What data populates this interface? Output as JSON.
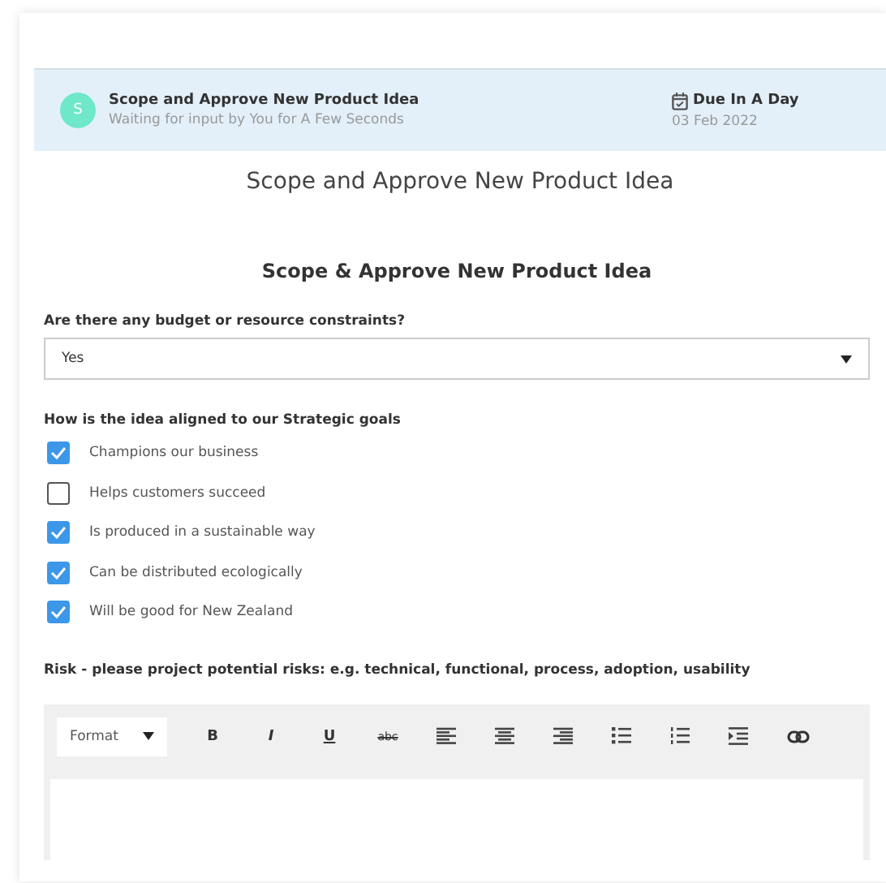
{
  "task": {
    "avatar": "S",
    "title": "Scope and Approve New Product Idea",
    "subtitle": "Waiting for input by You for A Few Seconds",
    "due": "Due In A Day",
    "date": "03 Feb 2022"
  },
  "page_title": "Scope and Approve New Product Idea",
  "form": {
    "heading": "Scope & Approve New Product Idea",
    "budget": {
      "label": "Are there any budget or resource constraints?",
      "value": "Yes"
    },
    "goals": {
      "label": "How is the idea aligned to our Strategic goals",
      "options": [
        {
          "label": "Champions our business",
          "checked": true
        },
        {
          "label": "Helps customers succeed",
          "checked": false
        },
        {
          "label": "Is produced in a sustainable way",
          "checked": true
        },
        {
          "label": "Can be distributed ecologically",
          "checked": true
        },
        {
          "label": "Will be good for New Zealand",
          "checked": true
        }
      ]
    },
    "risk": {
      "label": "Risk - please project potential risks: e.g. technical, functional, process, adoption, usability",
      "toolbar": {
        "format": "Format",
        "buttons": [
          {
            "kind": "bold",
            "text": "B"
          },
          {
            "kind": "italic",
            "text": "I"
          },
          {
            "kind": "underline",
            "text": "U"
          },
          {
            "kind": "strike",
            "text": "abc"
          },
          {
            "kind": "align-left"
          },
          {
            "kind": "align-center"
          },
          {
            "kind": "align-right"
          },
          {
            "kind": "bullets"
          },
          {
            "kind": "numbers"
          },
          {
            "kind": "indent"
          },
          {
            "kind": "link"
          }
        ]
      }
    }
  }
}
